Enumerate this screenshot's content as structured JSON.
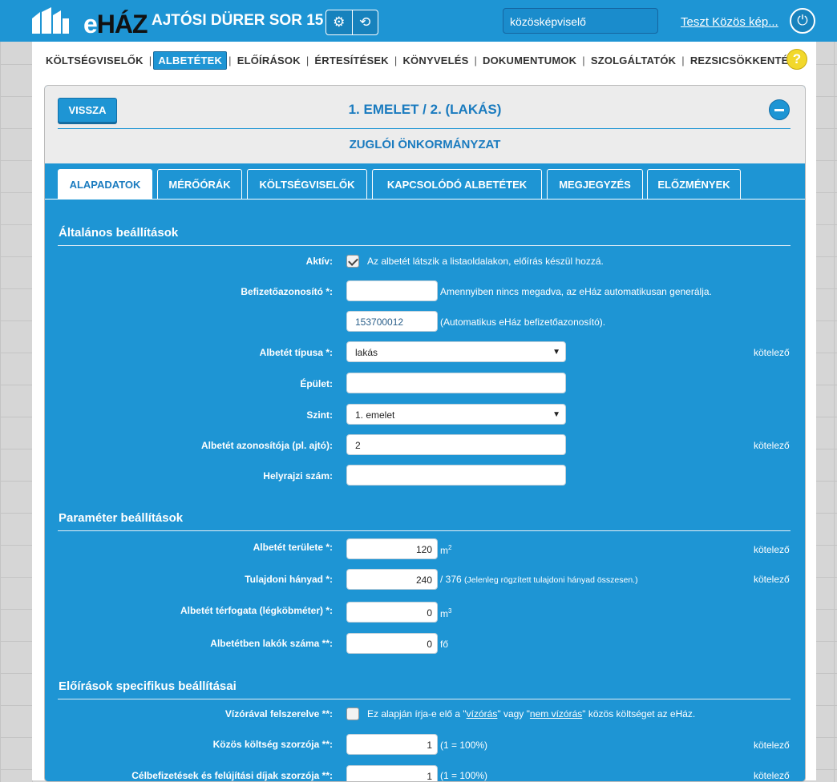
{
  "topbar": {
    "logo": {
      "part1": "e",
      "part2": "HÁZ"
    },
    "house_title": "AJTÓSI DÜRER SOR 15",
    "role_select": "közösképviselő",
    "user_link": "Teszt Közös kép..."
  },
  "menu": {
    "items": [
      "KÖLTSÉGVISELŐK",
      "ALBETÉTEK",
      "ELŐÍRÁSOK",
      "ÉRTESÍTÉSEK",
      "KÖNYVELÉS",
      "DOKUMENTUMOK",
      "SZOLGÁLTATÓK",
      "REZSICSÖKKENTÉS"
    ],
    "active": "ALBETÉTEK",
    "separator": "|",
    "help": "?"
  },
  "card": {
    "back": "VISSZA",
    "title": "1. EMELET / 2. (LAKÁS)",
    "subtitle": "ZUGLÓI ÖNKORMÁNYZAT"
  },
  "tabs": [
    "ALAPADATOK",
    "MÉRŐÓRÁK",
    "KÖLTSÉGVISELŐK",
    "KAPCSOLÓDÓ ALBETÉTEK",
    "MEGJEGYZÉS",
    "ELŐZMÉNYEK"
  ],
  "required_text": "kötelező",
  "general": {
    "title": "Általános beállítások",
    "active_label": "Aktív:",
    "active_checked": true,
    "active_note": "Az albetét látszik a listaoldalakon, előírás készül hozzá.",
    "payid_label": "Befizetőazonosító *:",
    "payid_value": "",
    "payid_note": "Amennyiben nincs megadva, az eHáz automatikusan generálja.",
    "auto_payid_value": "153700012",
    "auto_payid_note": "(Automatikus eHáz befizetőazonosító).",
    "type_label": "Albetét típusa *:",
    "type_value": "lakás",
    "building_label": "Épület:",
    "building_value": "",
    "level_label": "Szint:",
    "level_value": "1. emelet",
    "unit_id_label": "Albetét azonosítója (pl. ajtó):",
    "unit_id_value": "2",
    "parcel_label": "Helyrajzi szám:",
    "parcel_value": ""
  },
  "params": {
    "title": "Paraméter beállítások",
    "area_label": "Albetét területe *:",
    "area_value": "120",
    "area_unit": "m",
    "area_unit_sup": "2",
    "share_label": "Tulajdoni hányad *:",
    "share_value": "240",
    "share_total": "/ 376",
    "share_note": "(Jelenleg rögzített tulajdoni hányad összesen.)",
    "volume_label": "Albetét térfogata (légköbméter) *:",
    "volume_value": "0",
    "volume_unit": "m",
    "volume_unit_sup": "3",
    "residents_label": "Albetétben lakók száma **:",
    "residents_value": "0",
    "residents_unit": "fő"
  },
  "specific": {
    "title": "Előírások specifikus beállításai",
    "meter_label": "Vízórával felszerelve **:",
    "meter_checked": false,
    "meter_note_pre": "Ez alapján írja-e elő a \"",
    "meter_link1": "vízórás",
    "meter_note_mid": "\" vagy \"",
    "meter_link2": "nem vízórás",
    "meter_note_post": "\" közös költséget az eHáz.",
    "common_mult_label": "Közös költség szorzója **:",
    "common_mult_value": "1",
    "common_mult_note": "(1 = 100%)",
    "target_mult_label": "Célbefizetések és felújítási díjak szorzója **:",
    "target_mult_value": "1",
    "target_mult_note": "(1 = 100%)"
  }
}
